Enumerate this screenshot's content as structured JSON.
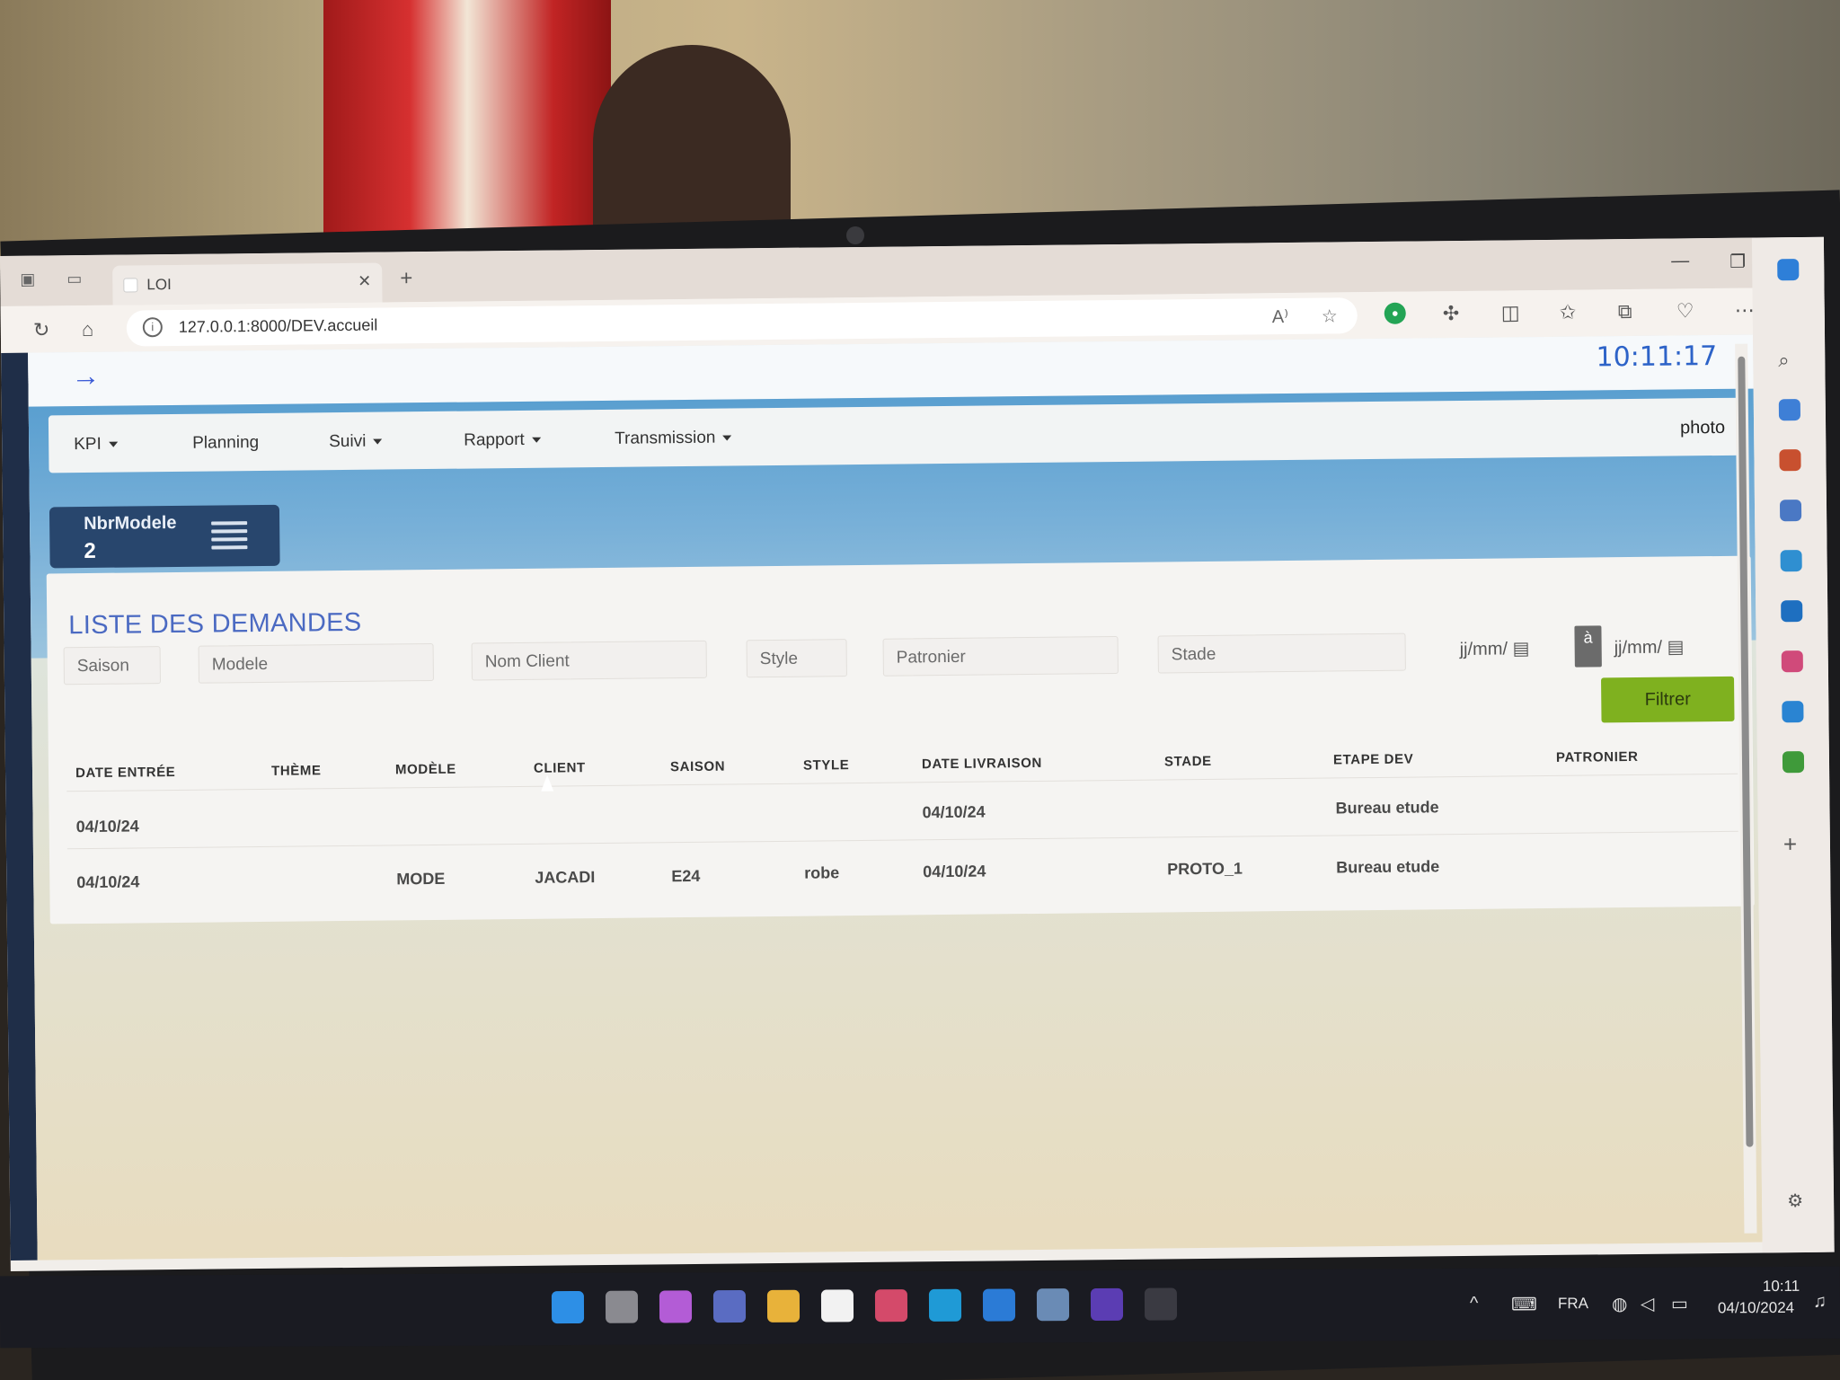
{
  "browser": {
    "tab_title": "LOI",
    "url": "127.0.0.1:8000/DEV.accueil"
  },
  "header": {
    "clock": "10:11:17",
    "photo_label": "photo"
  },
  "navbar": {
    "items": [
      {
        "label": "KPI",
        "dropdown": true
      },
      {
        "label": "Planning",
        "dropdown": false
      },
      {
        "label": "Suivi",
        "dropdown": true
      },
      {
        "label": "Rapport",
        "dropdown": true
      },
      {
        "label": "Transmission",
        "dropdown": true
      }
    ]
  },
  "kpi": {
    "label": "NbrModele",
    "value": "2"
  },
  "list": {
    "title": "LISTE DES DEMANDES",
    "filters": {
      "saison": "Saison",
      "modele": "Modele",
      "nom_client": "Nom Client",
      "style": "Style",
      "patronier": "Patronier",
      "stade": "Stade",
      "date_from": "jj/mm/",
      "date_sep": "à",
      "date_to": "jj/mm/"
    },
    "filter_button": "Filtrer",
    "columns": [
      "DATE ENTRÉE",
      "THÈME",
      "MODÈLE",
      "CLIENT",
      "SAISON",
      "STYLE",
      "DATE LIVRAISON",
      "STADE",
      "ETAPE DEV",
      "PATRONIER"
    ],
    "rows": [
      {
        "date_entree": "04/10/24",
        "theme": "",
        "modele": "",
        "client": "",
        "saison": "",
        "style": "",
        "date_livraison": "04/10/24",
        "stade": "",
        "etape_dev": "Bureau etude",
        "patronier": ""
      },
      {
        "date_entree": "04/10/24",
        "theme": "",
        "modele": "MODE",
        "client": "JACADI",
        "saison": "E24",
        "style": "robe",
        "date_livraison": "04/10/24",
        "stade": "PROTO_1",
        "etape_dev": "Bureau etude",
        "patronier": ""
      }
    ]
  },
  "taskbar": {
    "language": "FRA",
    "time": "10:11",
    "date": "04/10/2024"
  },
  "colors": {
    "accent_blue": "#4b6ac2",
    "kpi_card": "#28466d",
    "filter_button": "#7fb11f",
    "band_blue": "#5a9fd0"
  }
}
